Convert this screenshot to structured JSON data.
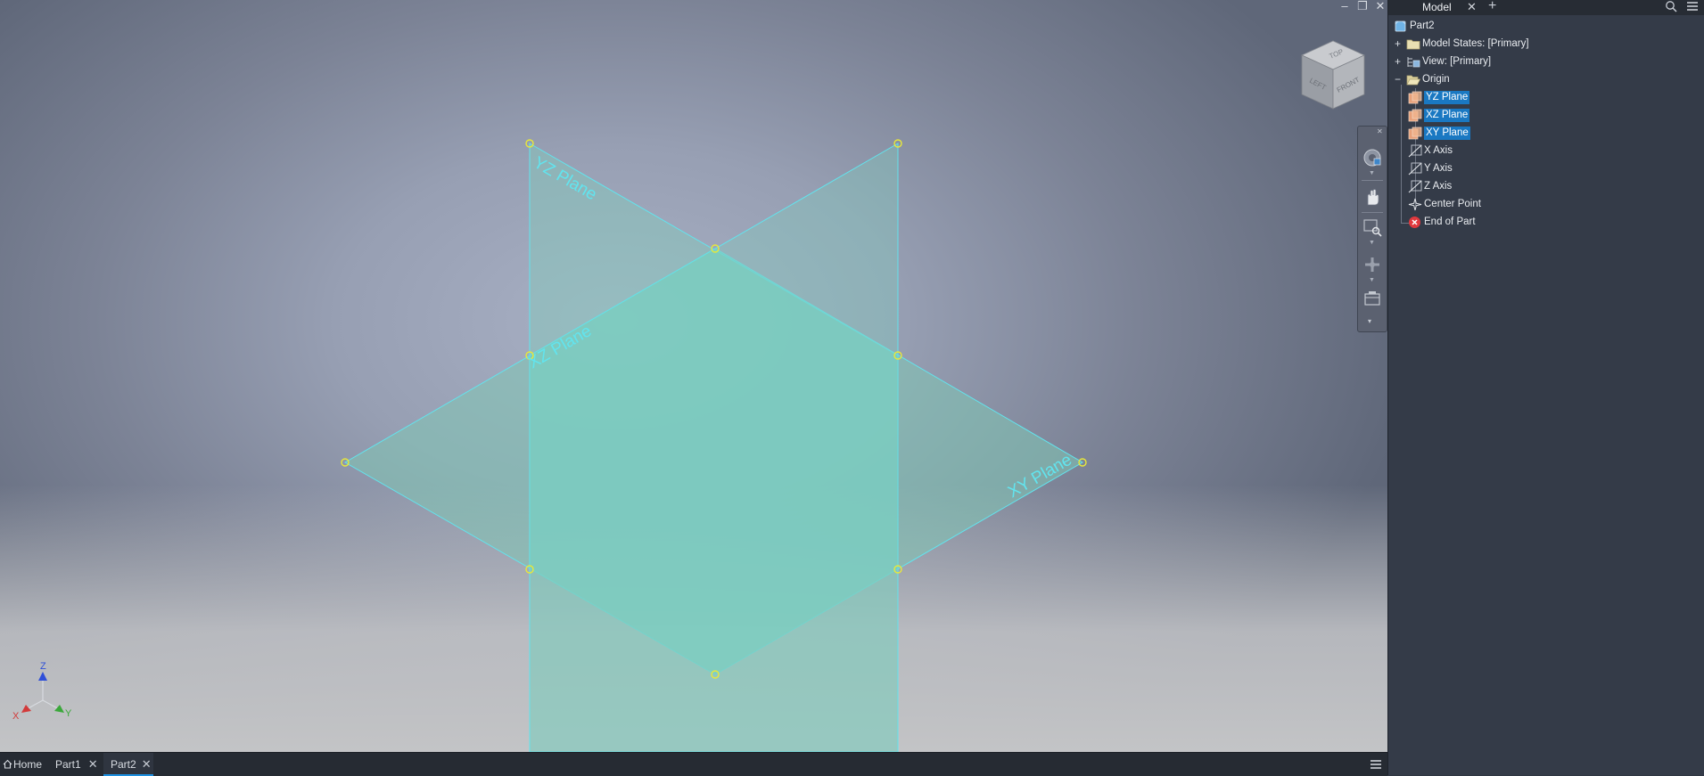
{
  "viewport": {
    "plane_labels": {
      "yz": "YZ Plane",
      "xz": "XZ Plane",
      "xy": "XY Plane"
    },
    "viewcube": {
      "top": "TOP",
      "left": "LEFT",
      "front": "FRONT"
    },
    "triad": {
      "x": "X",
      "y": "Y",
      "z": "Z"
    },
    "colors": {
      "plane_fill": "#6fd3c8",
      "plane_edge": "#5fe6f0",
      "vertex": "#e8e83a",
      "x_axis": "#d23a3a",
      "y_axis": "#3aa83a",
      "z_axis": "#2f4fd8"
    }
  },
  "window_controls": {
    "minimize": "–",
    "restore": "❐",
    "close": "✕"
  },
  "nav_bar": {
    "items": [
      "full-navigation-wheel-icon",
      "pan-icon",
      "zoom-icon",
      "orbit-icon",
      "view-face-icon"
    ]
  },
  "tabs": [
    {
      "label": "Home",
      "closable": false
    },
    {
      "label": "Part1",
      "closable": true
    },
    {
      "label": "Part2",
      "closable": true,
      "active": true
    }
  ],
  "browser": {
    "tab_label": "Model",
    "close": "✕",
    "add": "+",
    "root": "Part2",
    "items": [
      {
        "label": "Model States: [Primary]",
        "expander": "+",
        "icon": "folder-icon"
      },
      {
        "label": "View: [Primary]",
        "expander": "+",
        "icon": "view-rep-icon"
      },
      {
        "label": "Origin",
        "expander": "−",
        "icon": "open-folder-icon"
      },
      {
        "label": "YZ Plane",
        "icon": "work-plane-icon",
        "selected": true
      },
      {
        "label": "XZ Plane",
        "icon": "work-plane-icon",
        "selected": true
      },
      {
        "label": "XY Plane",
        "icon": "work-plane-icon",
        "selected": true
      },
      {
        "label": "X Axis",
        "icon": "work-axis-icon"
      },
      {
        "label": "Y Axis",
        "icon": "work-axis-icon"
      },
      {
        "label": "Z Axis",
        "icon": "work-axis-icon"
      },
      {
        "label": "Center Point",
        "icon": "work-point-icon"
      },
      {
        "label": "End of Part",
        "icon": "end-of-part-icon"
      }
    ]
  }
}
